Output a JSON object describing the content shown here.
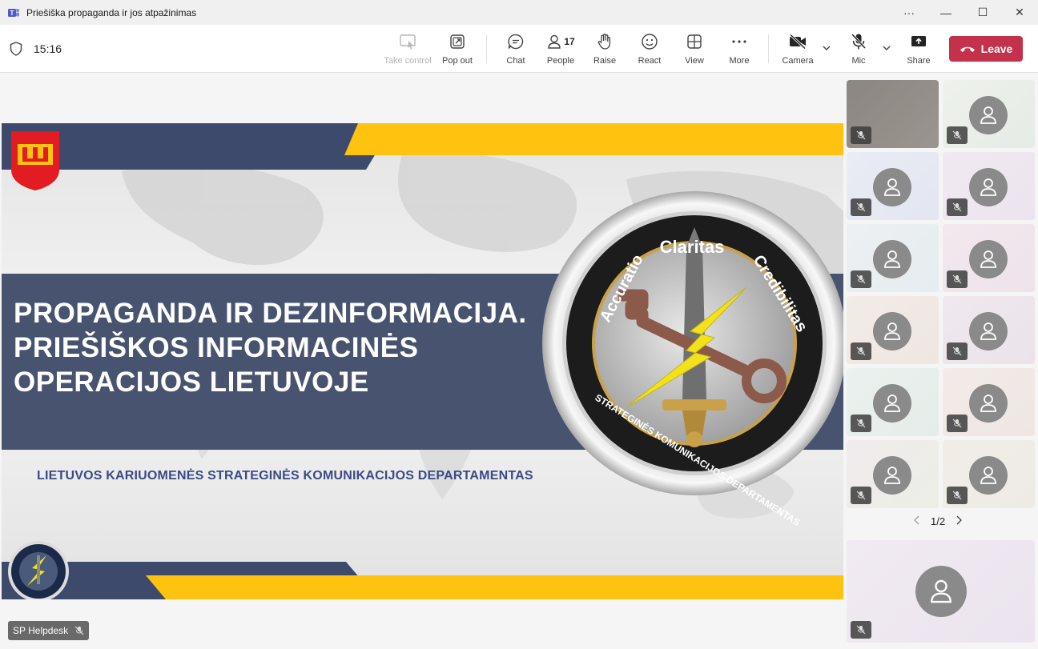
{
  "window": {
    "title": "Priešiška propaganda ir jos atpažinimas",
    "more": "···",
    "minimize": "—",
    "maximize": "☐",
    "close": "✕"
  },
  "toolbar": {
    "timer": "15:16",
    "take_control": "Take control",
    "pop_out": "Pop out",
    "chat": "Chat",
    "people": "People",
    "people_count": "17",
    "raise": "Raise",
    "react": "React",
    "view": "View",
    "more": "More",
    "camera": "Camera",
    "mic": "Mic",
    "share": "Share",
    "leave": "Leave"
  },
  "slide": {
    "title": "PROPAGANDA IR DEZINFORMACIJA. PRIEŠIŠKOS INFORMACINĖS OPERACIJOS LIETUVOJE",
    "subtitle": "LIETUVOS KARIUOMENĖS STRATEGINĖS KOMUNIKACIJOS DEPARTAMENTAS",
    "seal_top": "Claritas",
    "seal_left": "Accuratio",
    "seal_right": "Credibilitas",
    "seal_bottom": "STRATEGINĖS KOMUNIKACIJOS DEPARTAMENTAS"
  },
  "presenter": {
    "name": "SP Helpdesk"
  },
  "gallery": {
    "page": "1/2"
  },
  "colors": {
    "navy": "#3d4a6b",
    "yellow": "#ffc20e",
    "leave": "#c4314b"
  }
}
